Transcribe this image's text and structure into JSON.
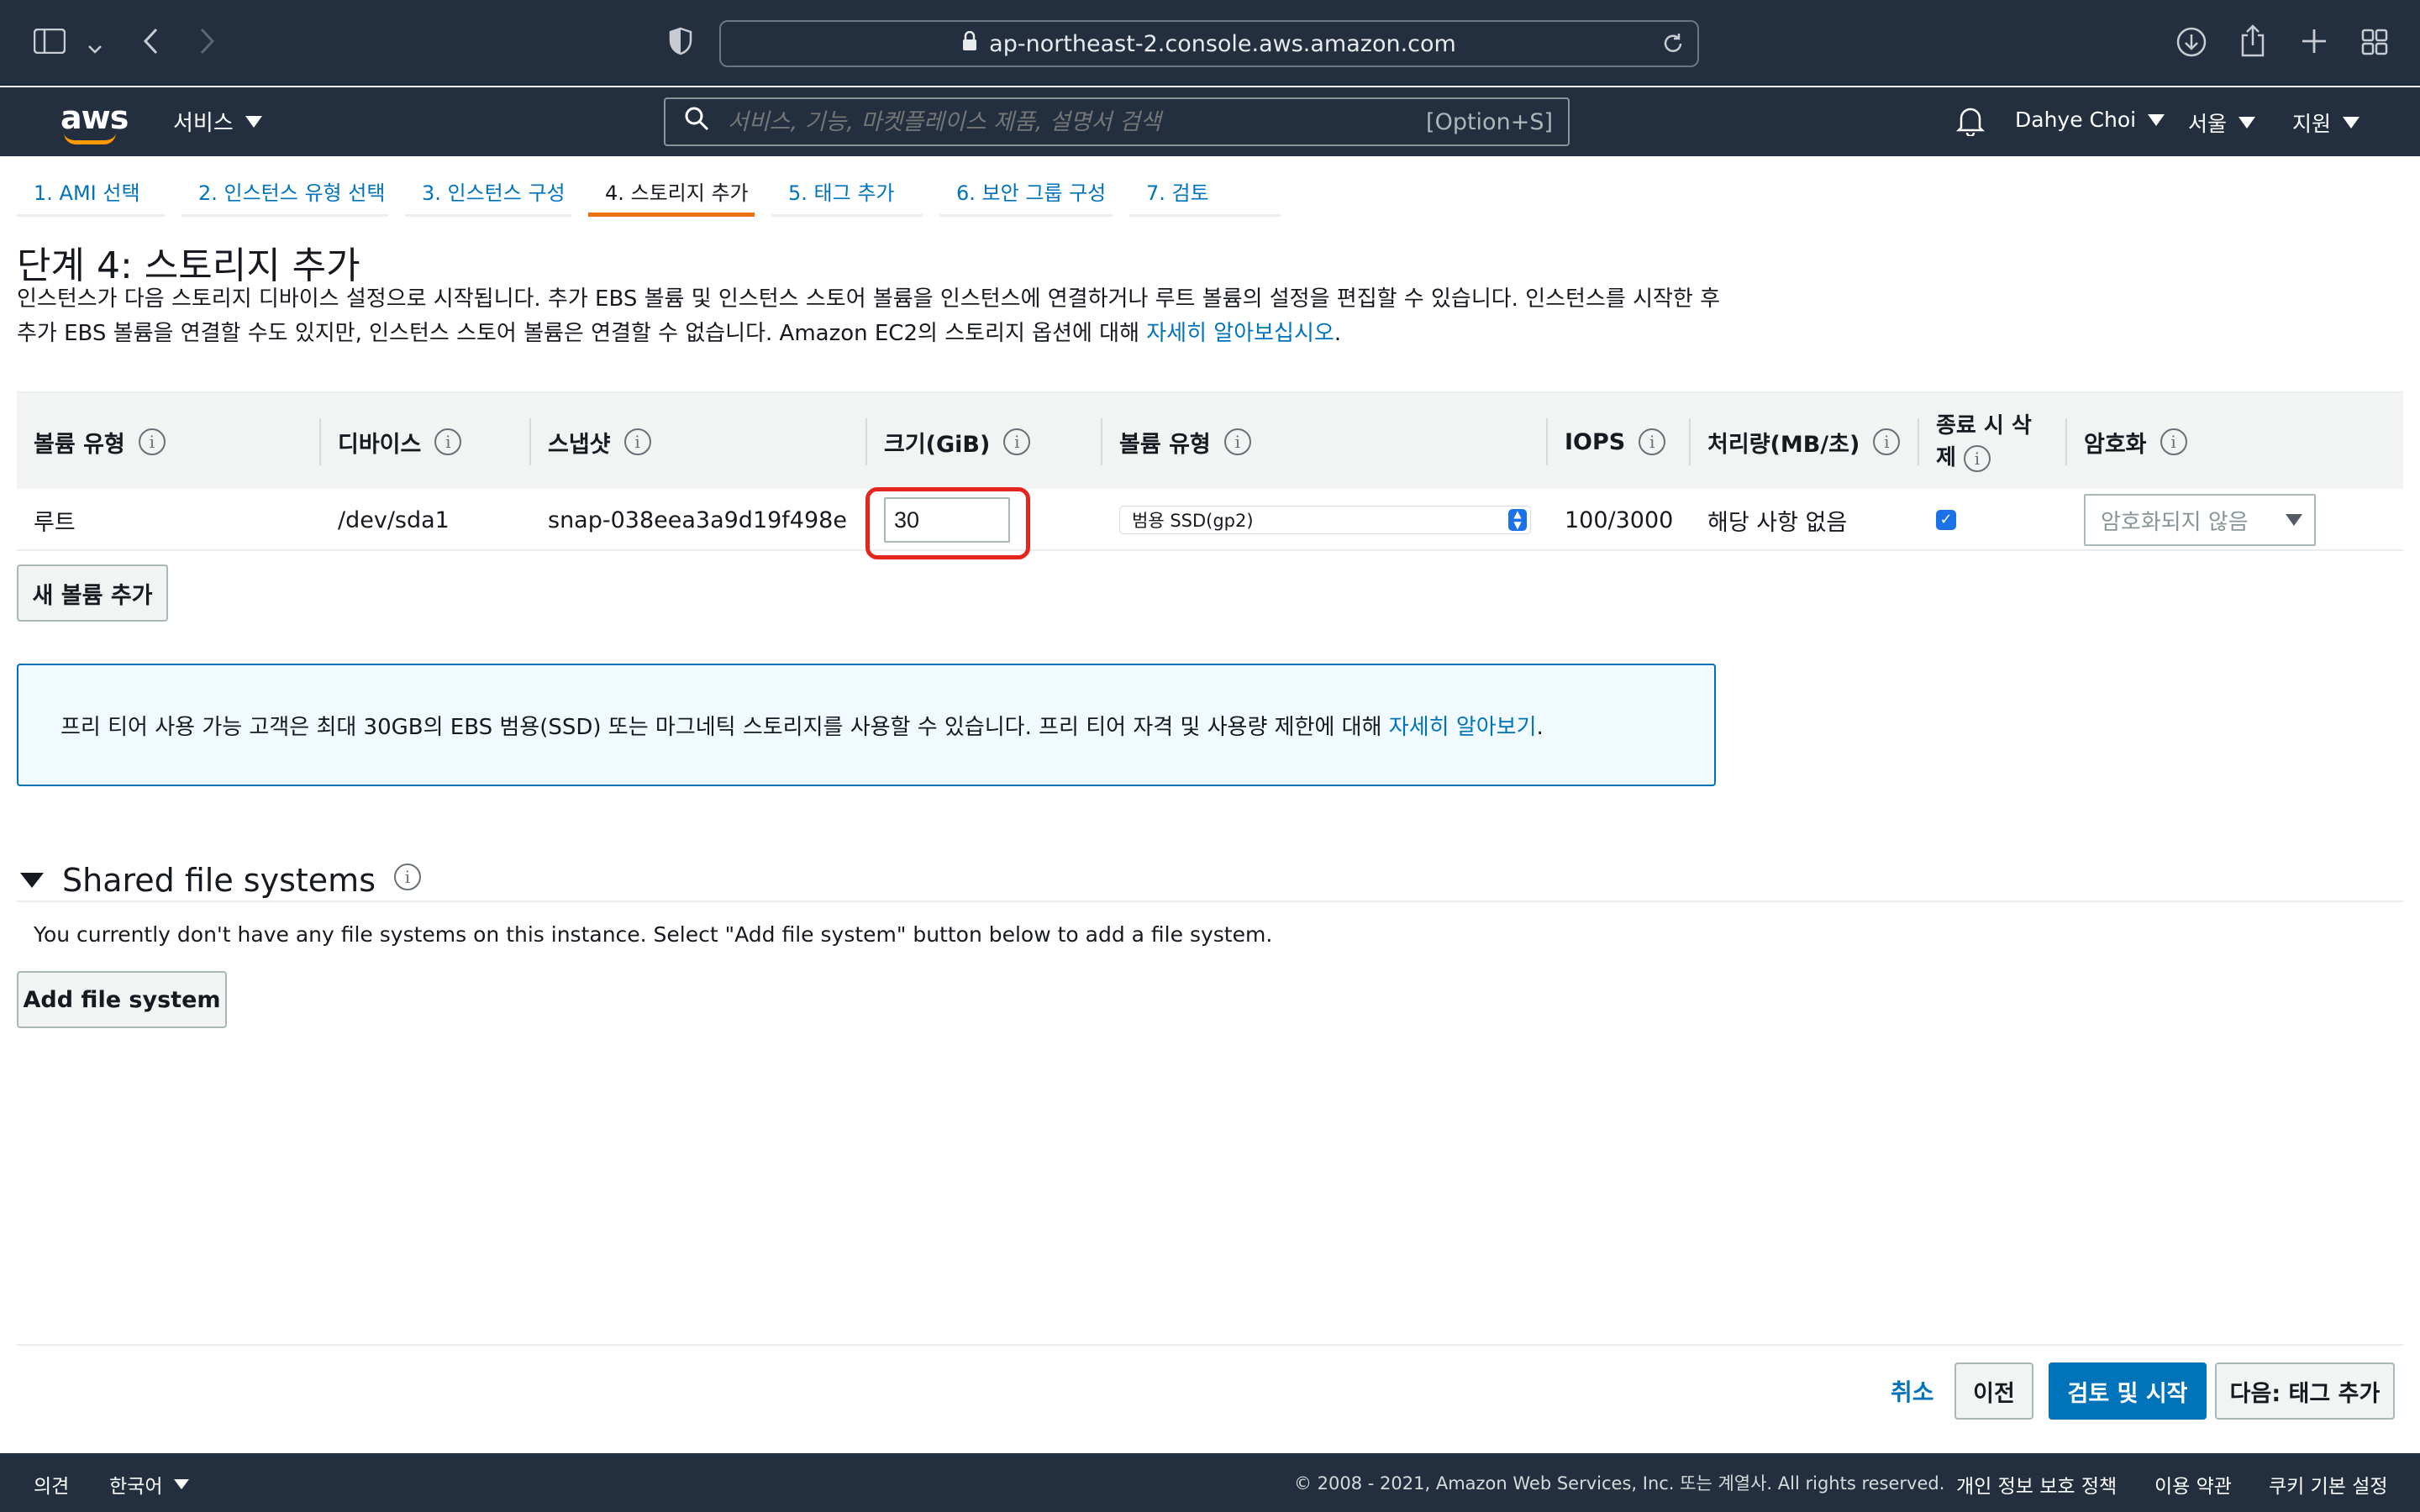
{
  "browser": {
    "url": "ap-northeast-2.console.aws.amazon.com"
  },
  "aws_nav": {
    "logo_text": "aws",
    "services_label": "서비스",
    "search_placeholder": "서비스, 기능, 마켓플레이스 제품, 설명서 검색",
    "search_shortcut": "[Option+S]",
    "user_name": "Dahye Choi",
    "region": "서울",
    "support": "지원"
  },
  "wizard_tabs": [
    {
      "label": "1. AMI 선택",
      "active": false
    },
    {
      "label": "2. 인스턴스 유형 선택",
      "active": false
    },
    {
      "label": "3. 인스턴스 구성",
      "active": false
    },
    {
      "label": "4. 스토리지 추가",
      "active": true
    },
    {
      "label": "5. 태그 추가",
      "active": false
    },
    {
      "label": "6. 보안 그룹 구성",
      "active": false
    },
    {
      "label": "7. 검토",
      "active": false
    }
  ],
  "page": {
    "title": "단계 4: 스토리지 추가",
    "description": "인스턴스가 다음 스토리지 디바이스 설정으로 시작됩니다. 추가 EBS 볼륨 및 인스턴스 스토어 볼륨을 인스턴스에 연결하거나 루트 볼륨의 설정을 편집할 수 있습니다. 인스턴스를 시작한 후 추가 EBS 볼륨을 연결할 수도 있지만, 인스턴스 스토어 볼륨은 연결할 수 없습니다. Amazon EC2의 스토리지 옵션에 대해 ",
    "description_link": "자세히 알아보십시오",
    "description_end": "."
  },
  "storage_table": {
    "headers": {
      "volume_type": "볼륨 유형",
      "device": "디바이스",
      "snapshot": "스냅샷",
      "size": "크기(GiB)",
      "volume_kind": "볼륨 유형",
      "iops": "IOPS",
      "throughput": "처리량(MB/초)",
      "delete_on_termination": "종료 시 삭제",
      "encryption": "암호화"
    },
    "row": {
      "volume_type": "루트",
      "device": "/dev/sda1",
      "snapshot": "snap-038eea3a9d19f498e",
      "size": "30",
      "volume_kind": "범용 SSD(gp2)",
      "iops": "100/3000",
      "throughput": "해당 사항 없음",
      "delete_on_termination": true,
      "encryption": "암호화되지 않음"
    },
    "add_volume_label": "새 볼륨 추가"
  },
  "notice": {
    "text": "프리 티어 사용 가능 고객은 최대 30GB의 EBS 범용(SSD) 또는 마그네틱 스토리지를 사용할 수 있습니다. 프리 티어 자격 및 사용량 제한에 대해 ",
    "link": "자세히 알아보기",
    "end": "."
  },
  "shared_fs": {
    "title": "Shared file systems",
    "description": "You currently don't have any file systems on this instance. Select \"Add file system\" button below to add a file system.",
    "add_label": "Add file system"
  },
  "actions": {
    "cancel": "취소",
    "previous": "이전",
    "review_launch": "검토 및 시작",
    "next": "다음: 태그 추가"
  },
  "footer": {
    "feedback": "의견",
    "language": "한국어",
    "copyright": "© 2008 - 2021, Amazon Web Services, Inc. 또는 계열사. All rights reserved.",
    "privacy": "개인 정보 보호 정책",
    "terms": "이용 약관",
    "cookies": "쿠키 기본 설정"
  },
  "colors": {
    "nav_bg": "#232f3e",
    "link": "#0073bb",
    "active_tab": "#ec7211",
    "primary_button": "#0073bb",
    "highlight": "#e4241d"
  },
  "icons": [
    "sidebar-icon",
    "back-icon",
    "forward-icon",
    "shield-icon",
    "lock-icon",
    "reload-icon",
    "download-icon",
    "share-icon",
    "new-tab-icon",
    "tab-overview-icon",
    "search-icon",
    "bell-icon",
    "info-icon"
  ]
}
